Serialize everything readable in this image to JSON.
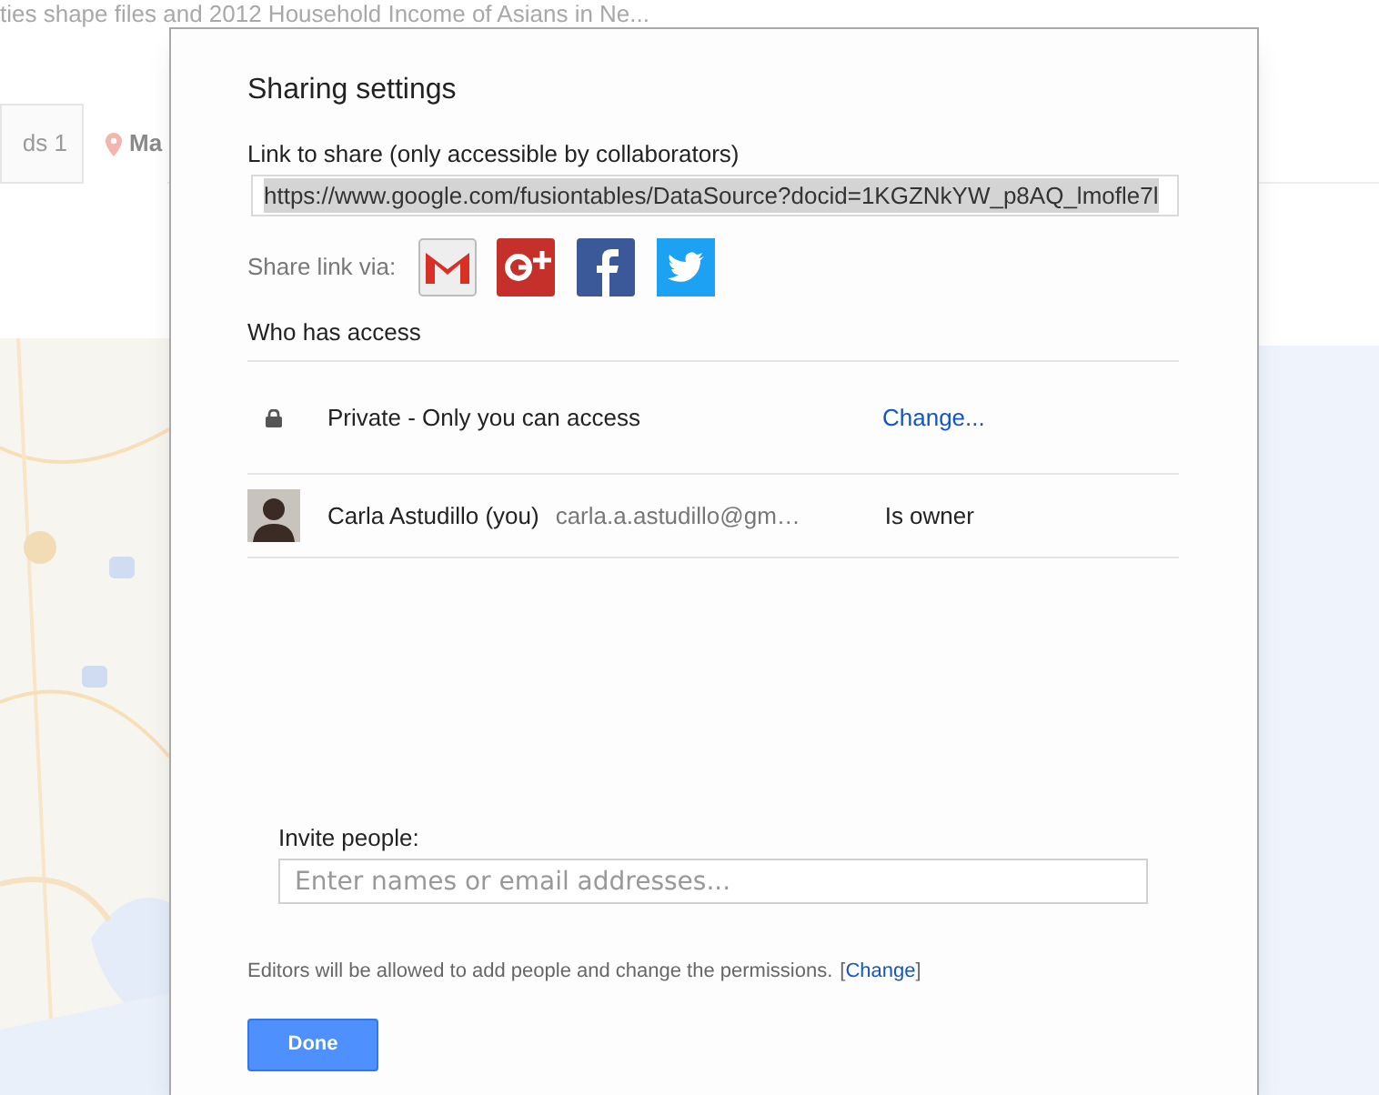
{
  "background": {
    "title": "ties shape files and 2012 Household Income of Asians in Ne...",
    "tabs": [
      {
        "label": "ds 1",
        "selected": false
      },
      {
        "label": "Ma",
        "selected": true
      }
    ]
  },
  "dialog": {
    "title": "Sharing settings",
    "link_label": "Link to share (only accessible by collaborators)",
    "link": {
      "value": "https://www.google.com/fusiontables/DataSource?docid=1KGZNkYW_p8AQ_lmofle7l",
      "text_selected": true
    },
    "share_label": "Share link via:",
    "share_services": [
      {
        "kind": "gmail"
      },
      {
        "kind": "gplus"
      },
      {
        "kind": "facebook"
      },
      {
        "kind": "twitter"
      }
    ],
    "access_heading": "Who has access",
    "access_rows": [
      {
        "kind": "visibility",
        "text": "Private - Only you can access",
        "action": "Change..."
      },
      {
        "kind": "person",
        "name": "Carla Astudillo (you)",
        "email": "carla.a.astudillo@gm…",
        "role": "Is owner"
      }
    ],
    "invite_label": "Invite people:",
    "invite_field": {
      "placeholder": "Enter names or email addresses..."
    },
    "note": "Editors will be allowed to add people and change the permissions.",
    "note_link": {
      "before": "[",
      "text": "Change",
      "after": "]"
    },
    "done_button": "Done"
  }
}
